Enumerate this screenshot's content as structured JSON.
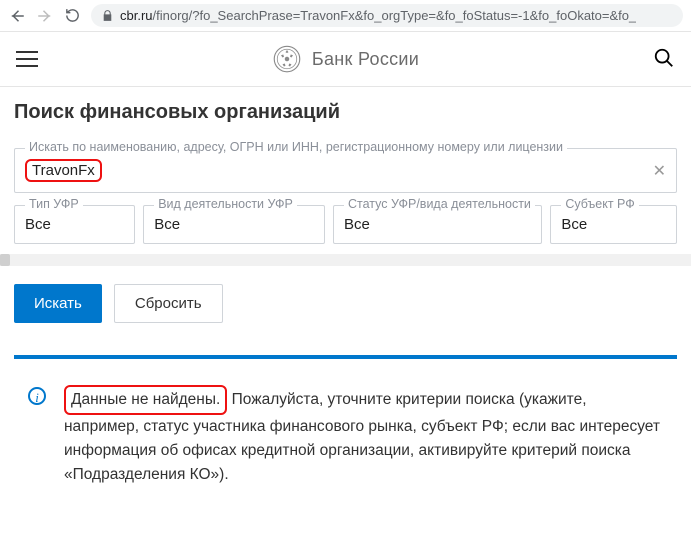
{
  "browser": {
    "url_host": "cbr.ru",
    "url_path": "/finorg/?fo_SearchPrase=TravonFx&fo_orgType=&fo_foStatus=-1&fo_foOkato=&fo_"
  },
  "header": {
    "brand": "Банк России"
  },
  "page": {
    "title": "Поиск финансовых организаций"
  },
  "search": {
    "label": "Искать по наименованию, адресу, ОГРН или ИНН, регистрационному номеру или лицензии",
    "value": "TravonFx"
  },
  "filters": {
    "type": {
      "label": "Тип УФР",
      "value": "Все"
    },
    "activity": {
      "label": "Вид деятельности УФР",
      "value": "Все"
    },
    "status": {
      "label": "Статус УФР/вида деятельности",
      "value": "Все"
    },
    "region": {
      "label": "Субъект РФ",
      "value": "Все"
    }
  },
  "buttons": {
    "search": "Искать",
    "reset": "Сбросить"
  },
  "alert": {
    "not_found": "Данные не найдены.",
    "rest": " Пожалуйста, уточните критерии поиска (укажите, например, статус участника финансового рынка, субъект РФ; если вас интересует информация об офисах кредитной организации, активируйте критерий поиска «Подразделения КО»)."
  }
}
